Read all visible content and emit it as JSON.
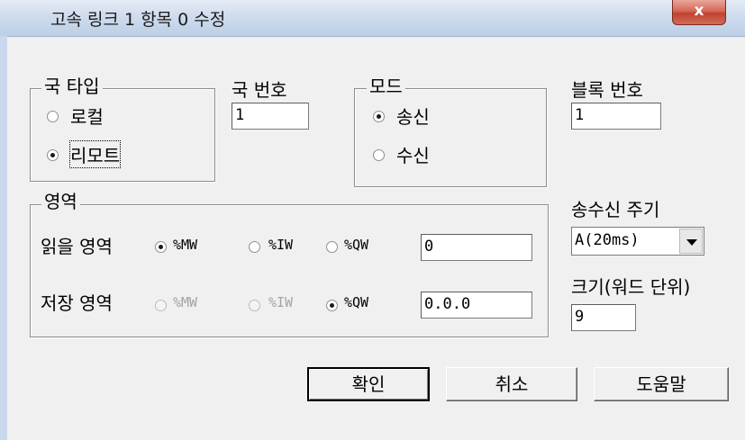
{
  "window": {
    "title": "고속 링크 1 항목 0 수정",
    "close_label": "x"
  },
  "station_type": {
    "legend": "국 타입",
    "options": [
      {
        "label": "로컬",
        "checked": false
      },
      {
        "label": "리모트",
        "checked": true
      }
    ]
  },
  "station_number": {
    "label": "국 번호",
    "value": "1"
  },
  "mode": {
    "legend": "모드",
    "options": [
      {
        "label": "송신",
        "checked": true
      },
      {
        "label": "수신",
        "checked": false
      }
    ]
  },
  "block_number": {
    "label": "블록 번호",
    "value": "1"
  },
  "area": {
    "legend": "영역",
    "read": {
      "label": "읽을 영역",
      "options": [
        "%MW",
        "%IW",
        "%QW"
      ],
      "selected": "%MW",
      "value": "0"
    },
    "save": {
      "label": "저장 영역",
      "options": [
        "%MW",
        "%IW",
        "%QW"
      ],
      "selected": "%QW",
      "value": "0.0.0"
    }
  },
  "cycle": {
    "label": "송수신 주기",
    "value": "A(20ms)"
  },
  "size": {
    "label": "크기(워드 단위)",
    "value": "9"
  },
  "buttons": {
    "ok": "확인",
    "cancel": "취소",
    "help": "도움말"
  }
}
